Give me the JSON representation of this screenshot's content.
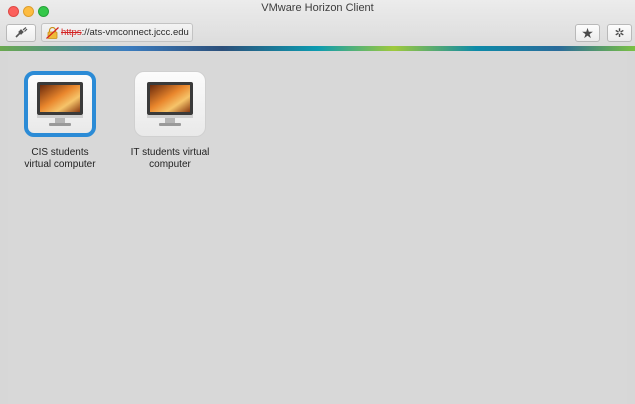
{
  "window": {
    "title": "VMware Horizon Client"
  },
  "toolbar": {
    "disconnect_icon": "disconnect-plug-icon",
    "url_scheme": "https",
    "url_rest": "://ats-vmconnect.jccc.edu",
    "lock_icon": "broken-lock-warning-icon",
    "favorite_icon": "star-icon",
    "settings_icon": "gear-icon"
  },
  "desktops": [
    {
      "label_line1": "CIS students",
      "label_line2": "virtual computer",
      "selected": true,
      "icon": "monitor-icon"
    },
    {
      "label_line1": "IT students virtual",
      "label_line2": "computer",
      "selected": false,
      "icon": "monitor-icon"
    }
  ],
  "colors": {
    "selection_accent": "#2b8bd6",
    "url_scheme_warning": "#d32121"
  }
}
